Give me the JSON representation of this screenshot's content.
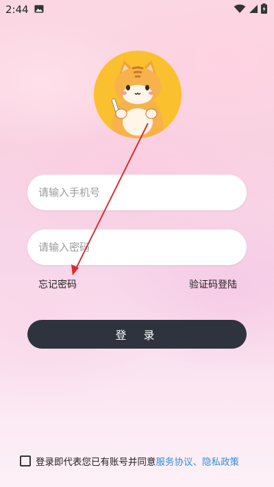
{
  "status_bar": {
    "time": "2:44",
    "icons": [
      "image-icon",
      "wifi-icon",
      "signal-icon",
      "battery-icon"
    ]
  },
  "avatar": {
    "icon": "cat-mascot"
  },
  "form": {
    "phone_placeholder": "请输入手机号",
    "password_placeholder": "请输入密码",
    "forgot_password": "忘记密码",
    "code_login": "验证码登陆",
    "login_button": "登 录"
  },
  "agreement": {
    "prefix": "登录即代表您已有账号并同意",
    "service_agreement": "服务协议",
    "separator": "、",
    "privacy_policy": "隐私政策",
    "checked": false
  },
  "colors": {
    "login_button_bg": "#2f333d",
    "link": "#2f8fd8",
    "annotation_arrow": "#d92c2c",
    "avatar_bg": "#fbc02d"
  }
}
